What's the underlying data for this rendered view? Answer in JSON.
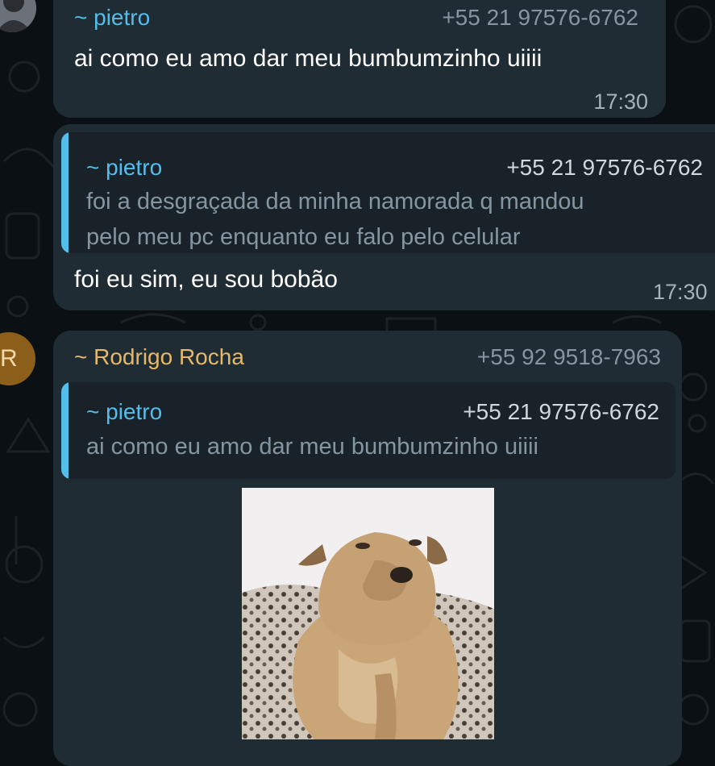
{
  "messages": [
    {
      "sender": "~ pietro",
      "phone": "+55 21 97576-6762",
      "text": "ai como eu amo dar meu bumbumzinho uiiii",
      "time": "17:30"
    },
    {
      "quote": {
        "sender": "~ pietro",
        "phone": "+55 21 97576-6762",
        "line1": "foi a desgraçada da minha namorada q mandou",
        "line2": "pelo meu pc enquanto eu falo pelo celular"
      },
      "text": "foi eu sim, eu sou bobão",
      "time": "17:30"
    },
    {
      "avatar_letter": "R",
      "sender": "~ Rodrigo Rocha",
      "phone": "+55 92 9518-7963",
      "quote": {
        "sender": "~ pietro",
        "phone": "+55 21 97576-6762",
        "text": "ai como eu amo dar meu bumbumzinho uiiii"
      },
      "image": "dog-photo"
    }
  ],
  "colors": {
    "bubble": "#1f2c33",
    "quote_bar": "#53bdeb",
    "pietro_name": "#53bdeb",
    "rodrigo_name": "#e6b96a",
    "avatar_r": "#8b5e1a"
  }
}
